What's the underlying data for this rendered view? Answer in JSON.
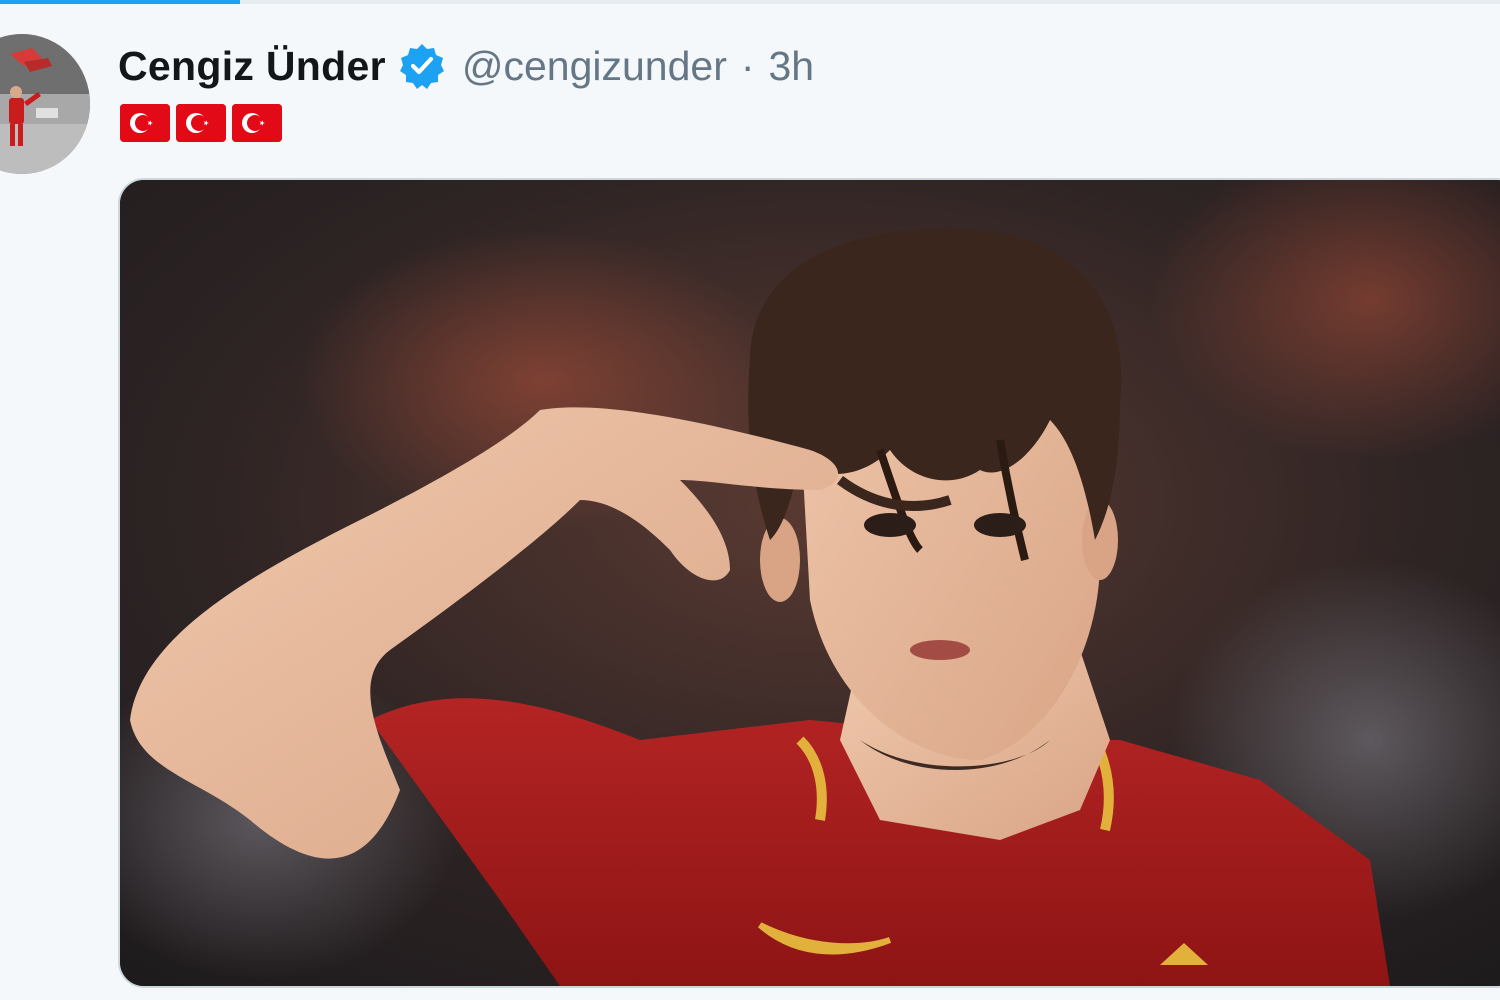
{
  "progress": {
    "fraction": 0.16,
    "color": "#1da1f2"
  },
  "tweet": {
    "author": {
      "display_name": "Cengiz Ünder",
      "handle": "@cengizunder",
      "verified": true,
      "avatar_icon": "profile-photo"
    },
    "separator": "·",
    "timestamp": "3h",
    "text_emojis": [
      "turkish-flag",
      "turkish-flag",
      "turkish-flag"
    ],
    "media": {
      "type": "photo",
      "icon": "football-player-salute-photo"
    }
  },
  "colors": {
    "background": "#f5f8fa",
    "name": "#14171a",
    "secondary": "#657786",
    "verified": "#1da1f2",
    "flag_red": "#e30a17"
  }
}
